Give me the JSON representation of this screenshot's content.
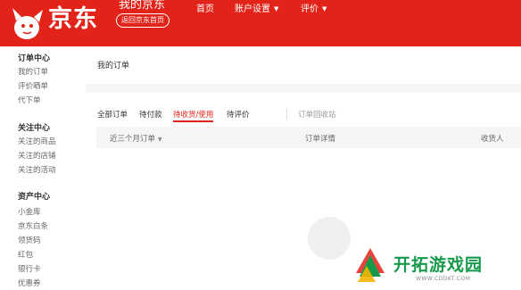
{
  "header": {
    "brand": "京东",
    "my_jd": "我的京东",
    "back_home": "返回京东首页",
    "nav": [
      {
        "label": "首页",
        "has_caret": false
      },
      {
        "label": "账户设置",
        "has_caret": true
      },
      {
        "label": "评价",
        "has_caret": true
      }
    ]
  },
  "sidebar": {
    "sections": [
      {
        "title": "订单中心",
        "items": [
          "我的订单",
          "评价晒单",
          "代下单"
        ]
      },
      {
        "title": "关注中心",
        "items": [
          "关注的商品",
          "关注的店铺",
          "关注的活动"
        ]
      },
      {
        "title": "资产中心",
        "items": [
          "小金库",
          "京东白条",
          "领货码",
          "红包",
          "银行卡",
          "优惠券"
        ]
      }
    ]
  },
  "main": {
    "title": "我的订单",
    "tabs": [
      "全部订单",
      "待付款",
      "待收货/使用",
      "待评价"
    ],
    "active_tab": "待收货/使用",
    "recycle": "订单回收站",
    "table_headers": {
      "period": "近三个月订单",
      "details": "订单详情",
      "receiver": "收货人"
    }
  },
  "watermark": {
    "text": "开拓游戏园",
    "url": "WWW.CDDKT.COM"
  },
  "colors": {
    "brand_red": "#e2231a",
    "watermark_green": "#159a4b"
  }
}
